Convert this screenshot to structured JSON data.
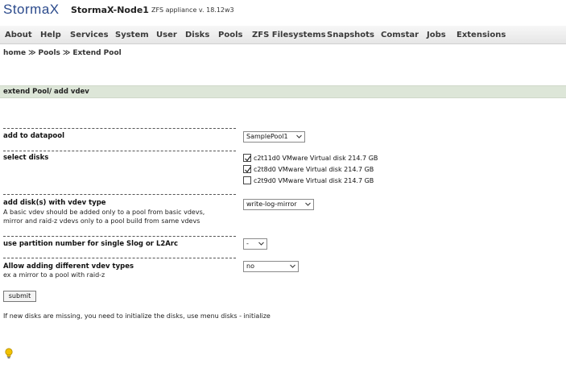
{
  "header": {
    "logo": "StormaX",
    "node_name": "StormaX-Node1",
    "appliance_version": "ZFS appliance v. 18.12w3"
  },
  "menu": [
    "About",
    "Help",
    "Services",
    "System",
    "User",
    "Disks",
    "Pools",
    "ZFS Filesystems",
    "Snapshots",
    "Comstar",
    "Jobs",
    "Extensions"
  ],
  "breadcrumb": {
    "items": [
      "home",
      "Pools",
      "Extend Pool"
    ],
    "separator": "≫"
  },
  "section_title": "extend Pool/ add vdev",
  "form": {
    "add_to_datapool": {
      "label": "add to datapool",
      "value": "SamplePool1"
    },
    "select_disks": {
      "label": "select disks",
      "disks": [
        {
          "name": "c2t11d0 VMware Virtual disk 214.7 GB",
          "checked": true
        },
        {
          "name": "c2t8d0 VMware Virtual disk 214.7 GB",
          "checked": true
        },
        {
          "name": "c2t9d0 VMware Virtual disk 214.7 GB",
          "checked": false
        }
      ]
    },
    "vdev_type": {
      "label": "add disk(s) with vdev type",
      "help_line1": "A basic vdev should be added only to a pool from basic vdevs,",
      "help_line2": "mirror and raid-z vdevs only to a pool build from same vdevs",
      "value": "write-log-mirror"
    },
    "partition_number": {
      "label": "use partition number for single Slog or L2Arc",
      "value": "-"
    },
    "allow_different": {
      "label": "Allow adding different vdev types",
      "help": "ex a mirror to a pool with raid-z",
      "value": "no"
    },
    "submit_label": "submit"
  },
  "note": "If new disks are missing, you need to initialize the disks, use menu disks - initialize",
  "colors": {
    "logo": "#2b4a8c",
    "section_bar": "#dde6d8",
    "menubar": "#e6e6e6",
    "bulb": "#f2c200"
  }
}
